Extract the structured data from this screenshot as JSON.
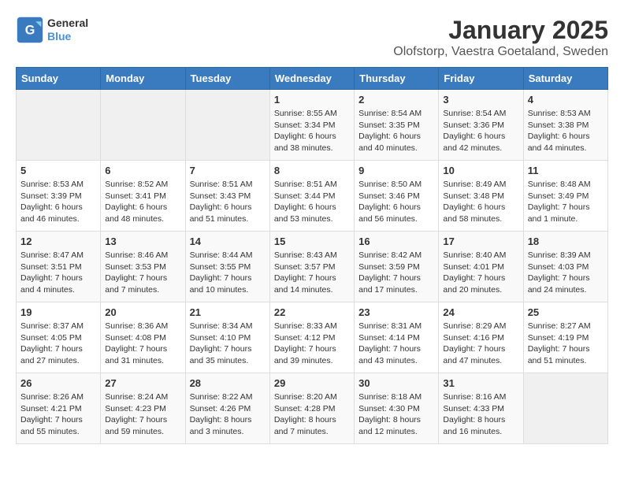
{
  "header": {
    "logo_line1": "General",
    "logo_line2": "Blue",
    "title": "January 2025",
    "subtitle": "Olofstorp, Vaestra Goetaland, Sweden"
  },
  "days_of_week": [
    "Sunday",
    "Monday",
    "Tuesday",
    "Wednesday",
    "Thursday",
    "Friday",
    "Saturday"
  ],
  "weeks": [
    [
      {
        "day": "",
        "content": ""
      },
      {
        "day": "",
        "content": ""
      },
      {
        "day": "",
        "content": ""
      },
      {
        "day": "1",
        "content": "Sunrise: 8:55 AM\nSunset: 3:34 PM\nDaylight: 6 hours\nand 38 minutes."
      },
      {
        "day": "2",
        "content": "Sunrise: 8:54 AM\nSunset: 3:35 PM\nDaylight: 6 hours\nand 40 minutes."
      },
      {
        "day": "3",
        "content": "Sunrise: 8:54 AM\nSunset: 3:36 PM\nDaylight: 6 hours\nand 42 minutes."
      },
      {
        "day": "4",
        "content": "Sunrise: 8:53 AM\nSunset: 3:38 PM\nDaylight: 6 hours\nand 44 minutes."
      }
    ],
    [
      {
        "day": "5",
        "content": "Sunrise: 8:53 AM\nSunset: 3:39 PM\nDaylight: 6 hours\nand 46 minutes."
      },
      {
        "day": "6",
        "content": "Sunrise: 8:52 AM\nSunset: 3:41 PM\nDaylight: 6 hours\nand 48 minutes."
      },
      {
        "day": "7",
        "content": "Sunrise: 8:51 AM\nSunset: 3:43 PM\nDaylight: 6 hours\nand 51 minutes."
      },
      {
        "day": "8",
        "content": "Sunrise: 8:51 AM\nSunset: 3:44 PM\nDaylight: 6 hours\nand 53 minutes."
      },
      {
        "day": "9",
        "content": "Sunrise: 8:50 AM\nSunset: 3:46 PM\nDaylight: 6 hours\nand 56 minutes."
      },
      {
        "day": "10",
        "content": "Sunrise: 8:49 AM\nSunset: 3:48 PM\nDaylight: 6 hours\nand 58 minutes."
      },
      {
        "day": "11",
        "content": "Sunrise: 8:48 AM\nSunset: 3:49 PM\nDaylight: 7 hours\nand 1 minute."
      }
    ],
    [
      {
        "day": "12",
        "content": "Sunrise: 8:47 AM\nSunset: 3:51 PM\nDaylight: 7 hours\nand 4 minutes."
      },
      {
        "day": "13",
        "content": "Sunrise: 8:46 AM\nSunset: 3:53 PM\nDaylight: 7 hours\nand 7 minutes."
      },
      {
        "day": "14",
        "content": "Sunrise: 8:44 AM\nSunset: 3:55 PM\nDaylight: 7 hours\nand 10 minutes."
      },
      {
        "day": "15",
        "content": "Sunrise: 8:43 AM\nSunset: 3:57 PM\nDaylight: 7 hours\nand 14 minutes."
      },
      {
        "day": "16",
        "content": "Sunrise: 8:42 AM\nSunset: 3:59 PM\nDaylight: 7 hours\nand 17 minutes."
      },
      {
        "day": "17",
        "content": "Sunrise: 8:40 AM\nSunset: 4:01 PM\nDaylight: 7 hours\nand 20 minutes."
      },
      {
        "day": "18",
        "content": "Sunrise: 8:39 AM\nSunset: 4:03 PM\nDaylight: 7 hours\nand 24 minutes."
      }
    ],
    [
      {
        "day": "19",
        "content": "Sunrise: 8:37 AM\nSunset: 4:05 PM\nDaylight: 7 hours\nand 27 minutes."
      },
      {
        "day": "20",
        "content": "Sunrise: 8:36 AM\nSunset: 4:08 PM\nDaylight: 7 hours\nand 31 minutes."
      },
      {
        "day": "21",
        "content": "Sunrise: 8:34 AM\nSunset: 4:10 PM\nDaylight: 7 hours\nand 35 minutes."
      },
      {
        "day": "22",
        "content": "Sunrise: 8:33 AM\nSunset: 4:12 PM\nDaylight: 7 hours\nand 39 minutes."
      },
      {
        "day": "23",
        "content": "Sunrise: 8:31 AM\nSunset: 4:14 PM\nDaylight: 7 hours\nand 43 minutes."
      },
      {
        "day": "24",
        "content": "Sunrise: 8:29 AM\nSunset: 4:16 PM\nDaylight: 7 hours\nand 47 minutes."
      },
      {
        "day": "25",
        "content": "Sunrise: 8:27 AM\nSunset: 4:19 PM\nDaylight: 7 hours\nand 51 minutes."
      }
    ],
    [
      {
        "day": "26",
        "content": "Sunrise: 8:26 AM\nSunset: 4:21 PM\nDaylight: 7 hours\nand 55 minutes."
      },
      {
        "day": "27",
        "content": "Sunrise: 8:24 AM\nSunset: 4:23 PM\nDaylight: 7 hours\nand 59 minutes."
      },
      {
        "day": "28",
        "content": "Sunrise: 8:22 AM\nSunset: 4:26 PM\nDaylight: 8 hours\nand 3 minutes."
      },
      {
        "day": "29",
        "content": "Sunrise: 8:20 AM\nSunset: 4:28 PM\nDaylight: 8 hours\nand 7 minutes."
      },
      {
        "day": "30",
        "content": "Sunrise: 8:18 AM\nSunset: 4:30 PM\nDaylight: 8 hours\nand 12 minutes."
      },
      {
        "day": "31",
        "content": "Sunrise: 8:16 AM\nSunset: 4:33 PM\nDaylight: 8 hours\nand 16 minutes."
      },
      {
        "day": "",
        "content": ""
      }
    ]
  ]
}
